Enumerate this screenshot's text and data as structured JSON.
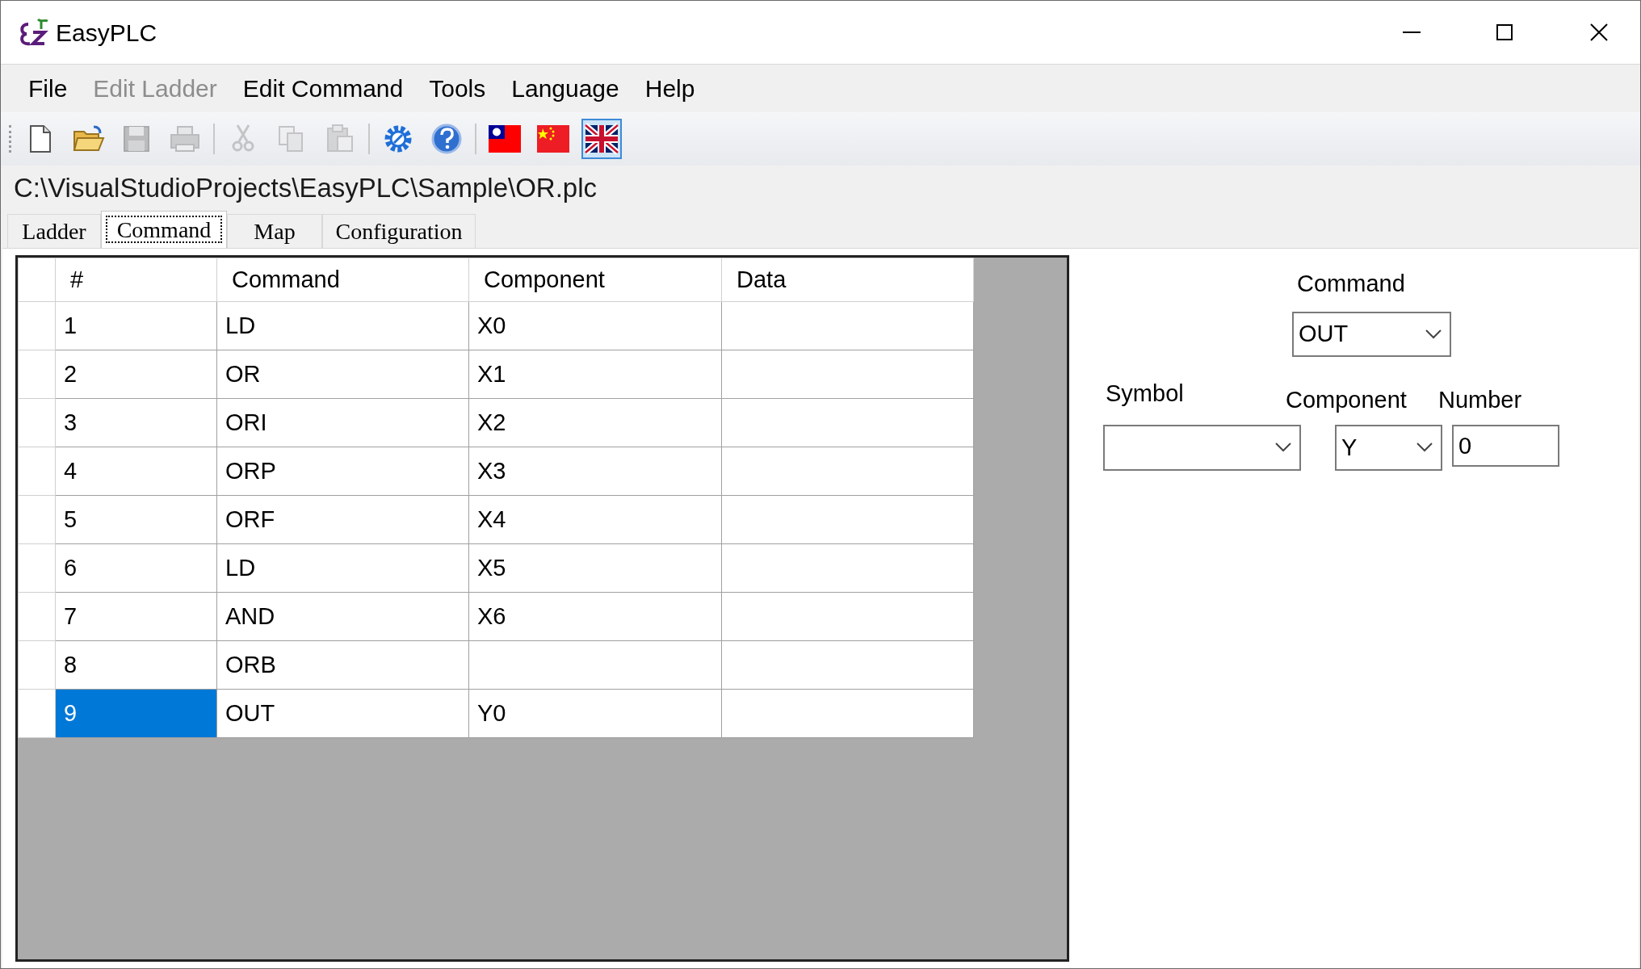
{
  "window": {
    "title": "EasyPLC"
  },
  "menu": [
    {
      "label": "File",
      "disabled": false
    },
    {
      "label": "Edit Ladder",
      "disabled": true
    },
    {
      "label": "Edit Command",
      "disabled": false
    },
    {
      "label": "Tools",
      "disabled": false
    },
    {
      "label": "Language",
      "disabled": false
    },
    {
      "label": "Help",
      "disabled": false
    }
  ],
  "toolbar": [
    {
      "kind": "new",
      "disabled": false,
      "selected": false
    },
    {
      "kind": "open",
      "disabled": false,
      "selected": false
    },
    {
      "kind": "save",
      "disabled": true,
      "selected": false
    },
    {
      "kind": "print",
      "disabled": true,
      "selected": false
    },
    {
      "kind": "sep"
    },
    {
      "kind": "cut",
      "disabled": true,
      "selected": false
    },
    {
      "kind": "copy",
      "disabled": true,
      "selected": false
    },
    {
      "kind": "paste",
      "disabled": true,
      "selected": false
    },
    {
      "kind": "sep"
    },
    {
      "kind": "settings",
      "disabled": false,
      "selected": false
    },
    {
      "kind": "help",
      "disabled": false,
      "selected": false
    },
    {
      "kind": "sep"
    },
    {
      "kind": "flag_tw",
      "disabled": false,
      "selected": false
    },
    {
      "kind": "flag_cn",
      "disabled": false,
      "selected": false
    },
    {
      "kind": "flag_uk",
      "disabled": false,
      "selected": true
    }
  ],
  "file_path": "C:\\VisualStudioProjects\\EasyPLC\\Sample\\OR.plc",
  "tabs": [
    {
      "label": "Ladder",
      "selected": false
    },
    {
      "label": "Command",
      "selected": true
    },
    {
      "label": "Map",
      "selected": false
    },
    {
      "label": "Configuration",
      "selected": false
    }
  ],
  "table": {
    "columns": [
      "#",
      "Command",
      "Component",
      "Data"
    ],
    "rows": [
      {
        "cells": [
          "1",
          "LD",
          "X0",
          ""
        ],
        "selected": false
      },
      {
        "cells": [
          "2",
          "OR",
          "X1",
          ""
        ],
        "selected": false
      },
      {
        "cells": [
          "3",
          "ORI",
          "X2",
          ""
        ],
        "selected": false
      },
      {
        "cells": [
          "4",
          "ORP",
          "X3",
          ""
        ],
        "selected": false
      },
      {
        "cells": [
          "5",
          "ORF",
          "X4",
          ""
        ],
        "selected": false
      },
      {
        "cells": [
          "6",
          "LD",
          "X5",
          ""
        ],
        "selected": false
      },
      {
        "cells": [
          "7",
          "AND",
          "X6",
          ""
        ],
        "selected": false
      },
      {
        "cells": [
          "8",
          "ORB",
          "",
          ""
        ],
        "selected": false
      },
      {
        "cells": [
          "9",
          "OUT",
          "Y0",
          ""
        ],
        "selected": true
      }
    ]
  },
  "editor": {
    "command": {
      "label": "Command",
      "value": "OUT"
    },
    "symbol": {
      "label": "Symbol"
    },
    "component": {
      "label": "Component",
      "value": "Y"
    },
    "number": {
      "label": "Number",
      "value": "0"
    }
  }
}
